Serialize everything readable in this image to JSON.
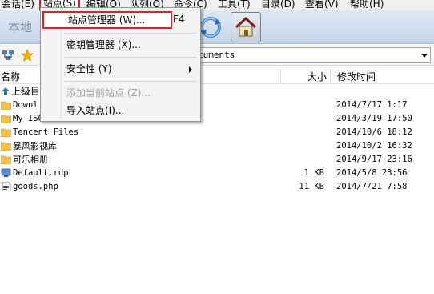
{
  "menubar": {
    "items": [
      {
        "label": "会话(E)"
      },
      {
        "label": "站点(S)"
      },
      {
        "label": "编辑(O)"
      },
      {
        "label": "队列(Q)"
      },
      {
        "label": "命令(C)"
      },
      {
        "label": "工具(T)"
      },
      {
        "label": "目录(D)"
      },
      {
        "label": "查看(V)"
      },
      {
        "label": "帮助(H)"
      }
    ]
  },
  "toolbar": {
    "local_title": "本地"
  },
  "pathbar": {
    "path": "cuments"
  },
  "list": {
    "headers": {
      "name": "名称",
      "size": "大小",
      "modified": "修改时间"
    },
    "up_label": "上级目",
    "rows": [
      {
        "name": "Downl",
        "size": "",
        "modified": "2014/7/17 1:17",
        "type": "folder"
      },
      {
        "name": "My ISO Files",
        "size": "",
        "modified": "2014/3/19 17:50",
        "type": "folder"
      },
      {
        "name": "Tencent Files",
        "size": "",
        "modified": "2014/10/6 18:12",
        "type": "folder"
      },
      {
        "name": "暴风影视库",
        "size": "",
        "modified": "2014/10/2 16:32",
        "type": "folder"
      },
      {
        "name": "可乐相册",
        "size": "",
        "modified": "2014/9/17 23:16",
        "type": "folder"
      },
      {
        "name": "Default.rdp",
        "size": "1 KB",
        "modified": "2014/5/8 23:56",
        "type": "rdp"
      },
      {
        "name": "goods.php",
        "size": "11 KB",
        "modified": "2014/7/21 7:58",
        "type": "php"
      }
    ]
  },
  "dropdown": {
    "items": [
      {
        "label": "站点管理器 (W)...",
        "shortcut": "F4"
      },
      {
        "label": "密钥管理器 (X)..."
      },
      {
        "label": "安全性 (Y)"
      },
      {
        "label": "添加当前站点 (Z)..."
      },
      {
        "label": "导入站点(I)..."
      }
    ]
  },
  "colors": {
    "highlight_border": "#d9232a",
    "folder": "#f3c14b"
  }
}
